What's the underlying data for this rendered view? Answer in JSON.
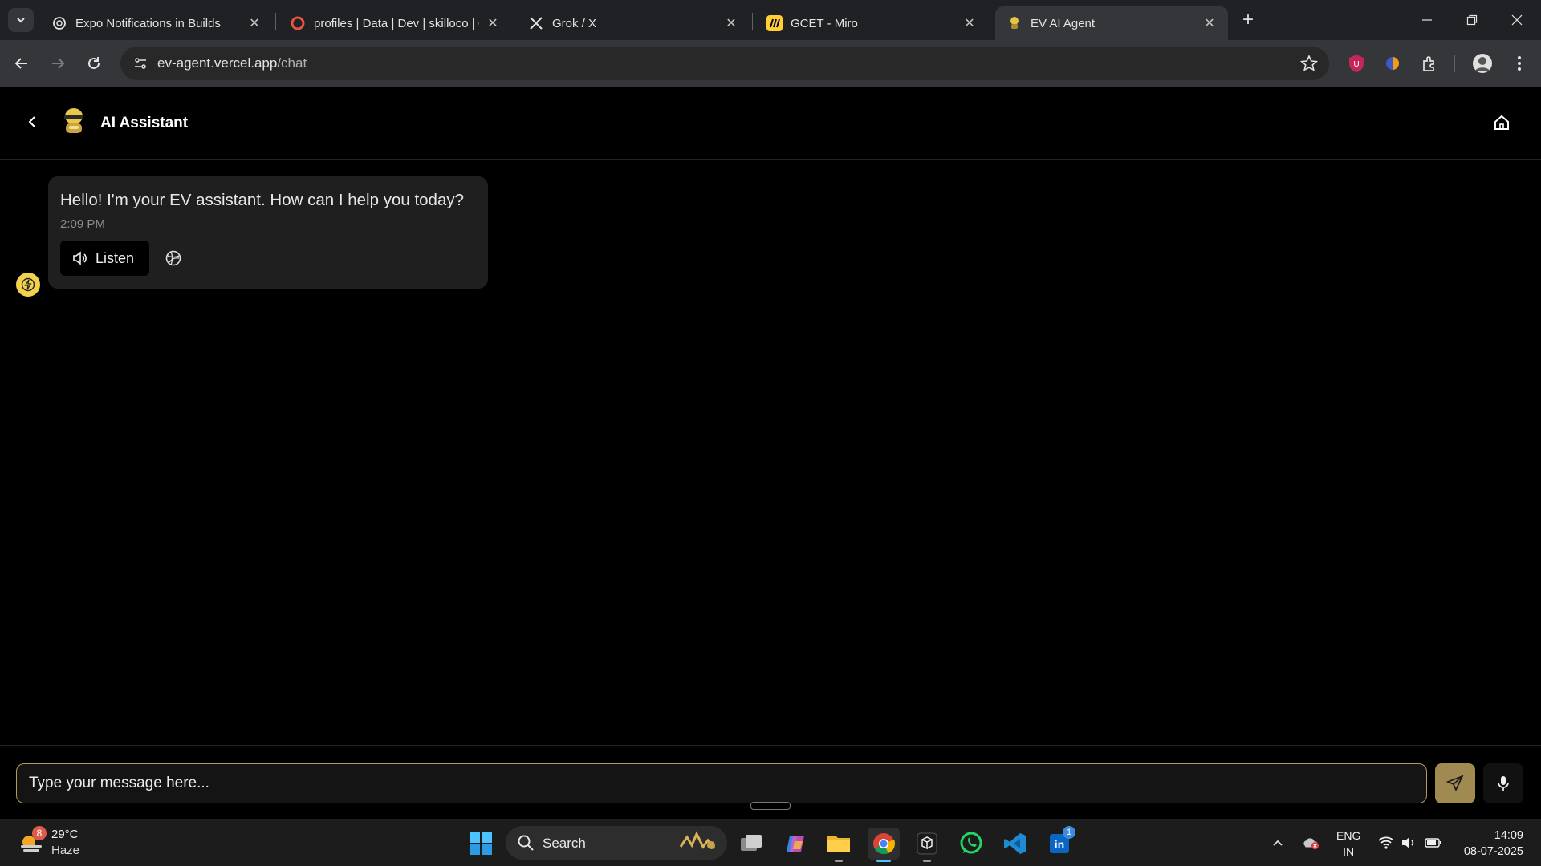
{
  "browser": {
    "tabs": [
      {
        "title": "Expo Notifications in Builds",
        "icon": "openai-icon"
      },
      {
        "title": "profiles | Data | Dev | skilloco | C",
        "icon": "supabase-icon"
      },
      {
        "title": "Grok / X",
        "icon": "x-icon"
      },
      {
        "title": "GCET - Miro",
        "icon": "miro-icon"
      },
      {
        "title": "EV AI Agent",
        "icon": "ev-agent-icon"
      }
    ],
    "url_host": "ev-agent.vercel.app",
    "url_path": "/chat"
  },
  "app": {
    "title": "AI Assistant",
    "accent": "#f2d24c"
  },
  "messages": [
    {
      "text": "Hello! I'm your EV assistant. How can I help you today?",
      "time": "2:09 PM",
      "listen_label": "Listen"
    }
  ],
  "composer": {
    "placeholder": "Type your message here..."
  },
  "taskbar": {
    "weather_temp": "29°C",
    "weather_cond": "Haze",
    "weather_badge": "8",
    "search_label": "Search",
    "linkedin_badge": "1",
    "lang_top": "ENG",
    "lang_bottom": "IN",
    "time": "14:09",
    "date": "08-07-2025"
  }
}
